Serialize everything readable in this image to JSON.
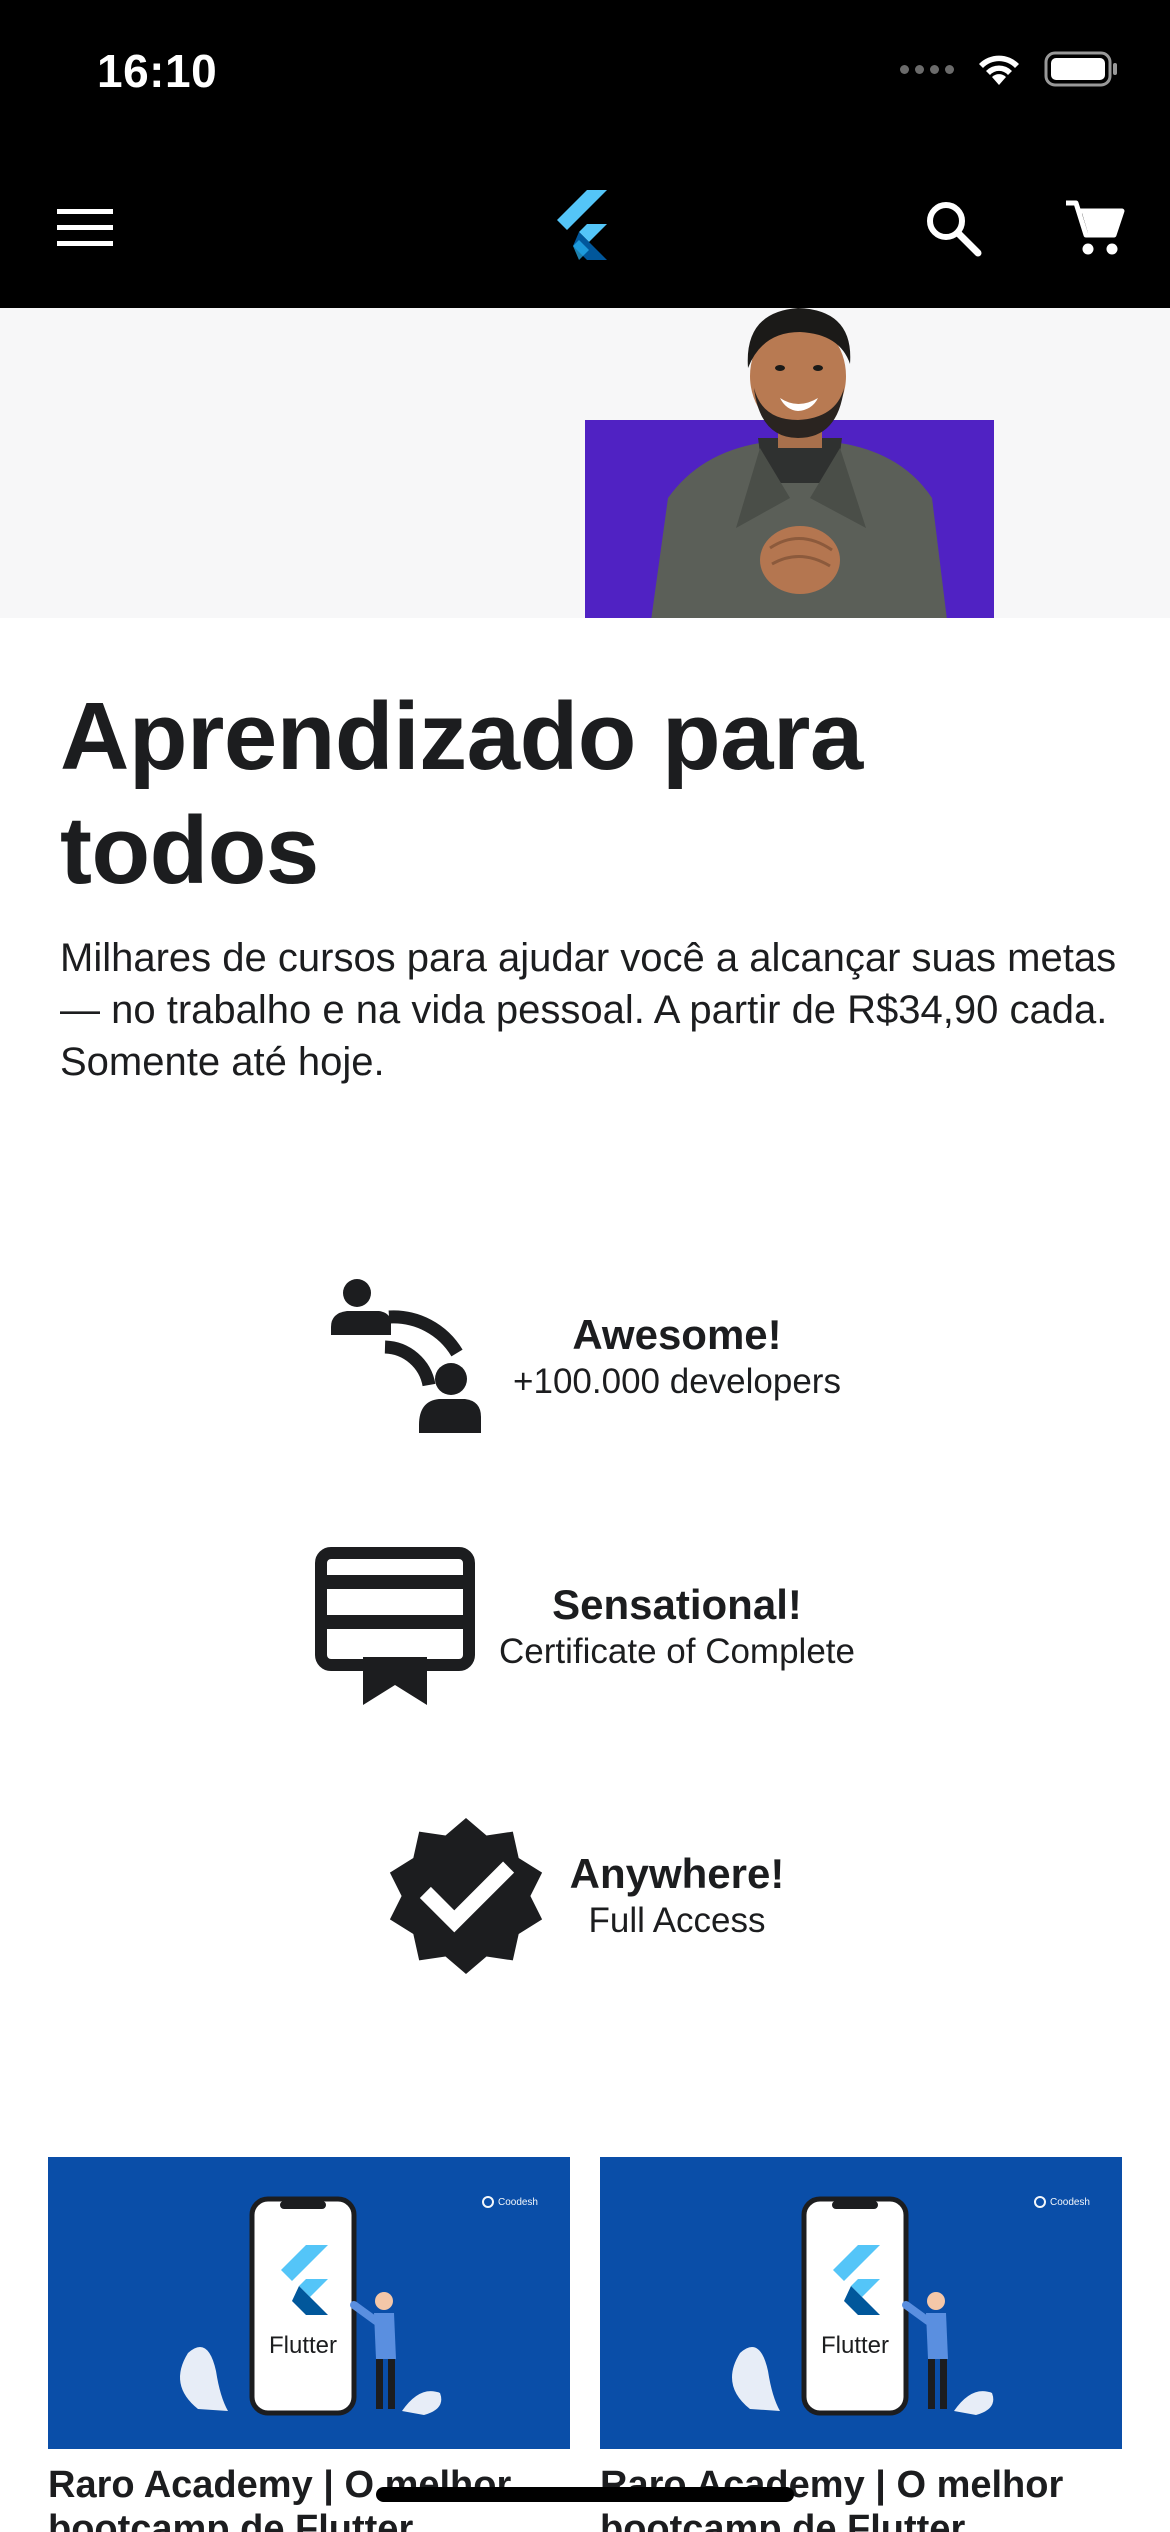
{
  "status_bar": {
    "time": "16:10"
  },
  "app_bar": {
    "icons": [
      "menu-icon",
      "flutter-logo",
      "search-icon",
      "cart-icon"
    ],
    "background": "#000000"
  },
  "hero": {
    "accent_color": "#5022c3"
  },
  "headline": {
    "title": "Aprendizado para todos",
    "description": "Milhares de cursos para ajudar você a alcançar suas metas — no trabalho e na vida pessoal. A partir de R$34,90 cada. Somente até hoje."
  },
  "features": [
    {
      "icon": "people-connect-icon",
      "title": "Awesome!",
      "subtitle": "+100.000 developers"
    },
    {
      "icon": "certificate-icon",
      "title": "Sensational!",
      "subtitle": "Certificate of Complete"
    },
    {
      "icon": "verified-badge-icon",
      "title": "Anywhere!",
      "subtitle": "Full Access"
    }
  ],
  "courses": [
    {
      "image_label": "Flutter",
      "brand": "Coodesh",
      "title": "Raro Academy | O melhor bootcamp de Flutter"
    },
    {
      "image_label": "Flutter",
      "brand": "Coodesh",
      "title": "Raro Academy | O melhor bootcamp de Flutter"
    }
  ],
  "colors": {
    "card_bg": "#0a4ea8",
    "flutter_light": "#54c5f8",
    "flutter_dark": "#01579b",
    "text": "#1c1d1f"
  }
}
